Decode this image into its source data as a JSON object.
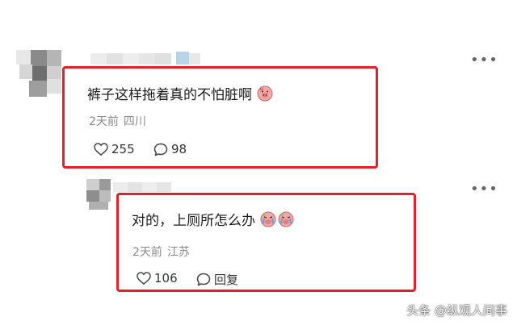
{
  "comment_1": {
    "text": "裤子这样拖着真的不怕脏啊",
    "emoji": "pig-face-emoji",
    "time": "2天前",
    "location": "四川",
    "likes": "255",
    "replies": "98"
  },
  "comment_2": {
    "text": "对的，上厕所怎么办",
    "emoji": "crying-pig-emoji",
    "time": "2天前",
    "location": "江苏",
    "likes": "106",
    "reply_label": "回复"
  },
  "watermark": "头条 @纵观人间事",
  "colors": {
    "highlight": "#e5202a",
    "meta": "#8a8a8a"
  }
}
